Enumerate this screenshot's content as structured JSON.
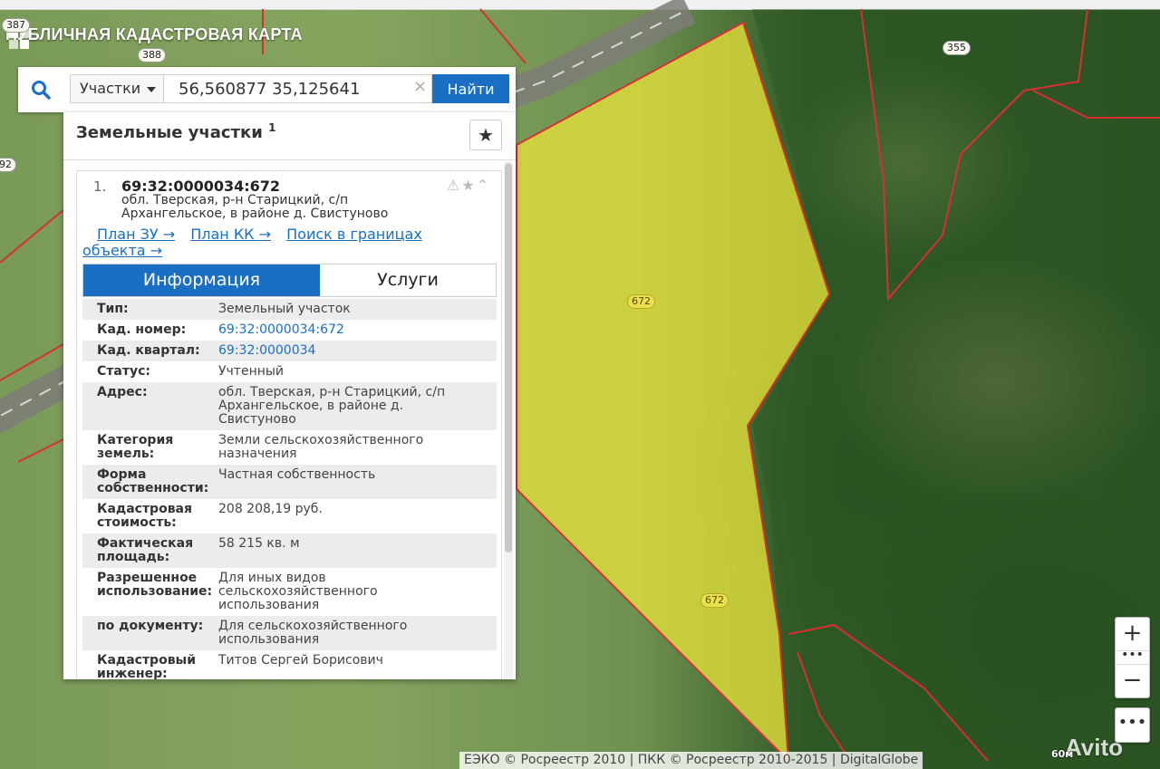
{
  "app": {
    "title": "ПУБЛИЧНАЯ КАДАСТРОВАЯ КАРТА"
  },
  "search": {
    "type_selected": "Участки",
    "query": "56,560877 35,125641",
    "clear_symbol": "×",
    "find_label": "Найти"
  },
  "panel": {
    "heading": "Земельные участки",
    "count": "1",
    "favorite_icon": "star-icon",
    "result": {
      "index": "1.",
      "cad_number": "69:32:0000034:672",
      "address": "обл. Тверская, р-н Старицкий, с/п Архангельское, в районе д. Свистуново",
      "links": [
        "План ЗУ →",
        "План КК →",
        "Поиск в границах объекта →"
      ],
      "tabs": [
        "Информация",
        "Услуги"
      ],
      "active_tab": "Информация",
      "fields": [
        {
          "key": "Тип:",
          "value": "Земельный участок"
        },
        {
          "key": "Кад. номер:",
          "value": "69:32:0000034:672"
        },
        {
          "key": "Кад. квартал:",
          "value": "69:32:0000034"
        },
        {
          "key": "Статус:",
          "value": "Учтенный"
        },
        {
          "key": "Адрес:",
          "value": "обл. Тверская, р-н Старицкий, с/п Архангельское, в районе д. Свистуново"
        },
        {
          "key": "Категория земель:",
          "value": "Земли сельскохозяйственного назначения"
        },
        {
          "key": "Форма собственности:",
          "value": "Частная собственность"
        },
        {
          "key": "Кадастровая стоимость:",
          "value": "208 208,19 руб."
        },
        {
          "key": "Фактическая площадь:",
          "value": "58 215 кв. м"
        },
        {
          "key": "Разрешенное использование:",
          "value": "Для иных видов сельскохозяйственного использования"
        },
        {
          "key": "по документу:",
          "value": "Для сельскохозяйственного использования"
        },
        {
          "key": "Кадастровый инженер:",
          "value": "Титов Сергей Борисович"
        }
      ]
    }
  },
  "map": {
    "parcel_labels": [
      "387",
      "388",
      "92",
      "355",
      "672",
      "672"
    ],
    "highlight_color": "#e6e23a",
    "boundary_color": "#d83030",
    "zoom_in": "+",
    "zoom_out": "−",
    "zoom_dots": "•••",
    "more": "•••",
    "attribution": "ЕЭКО © Росреестр 2010 | ПКК © Росреестр 2010-2015 | DigitalGlobe",
    "scale": "60м",
    "watermark": "Avito"
  }
}
